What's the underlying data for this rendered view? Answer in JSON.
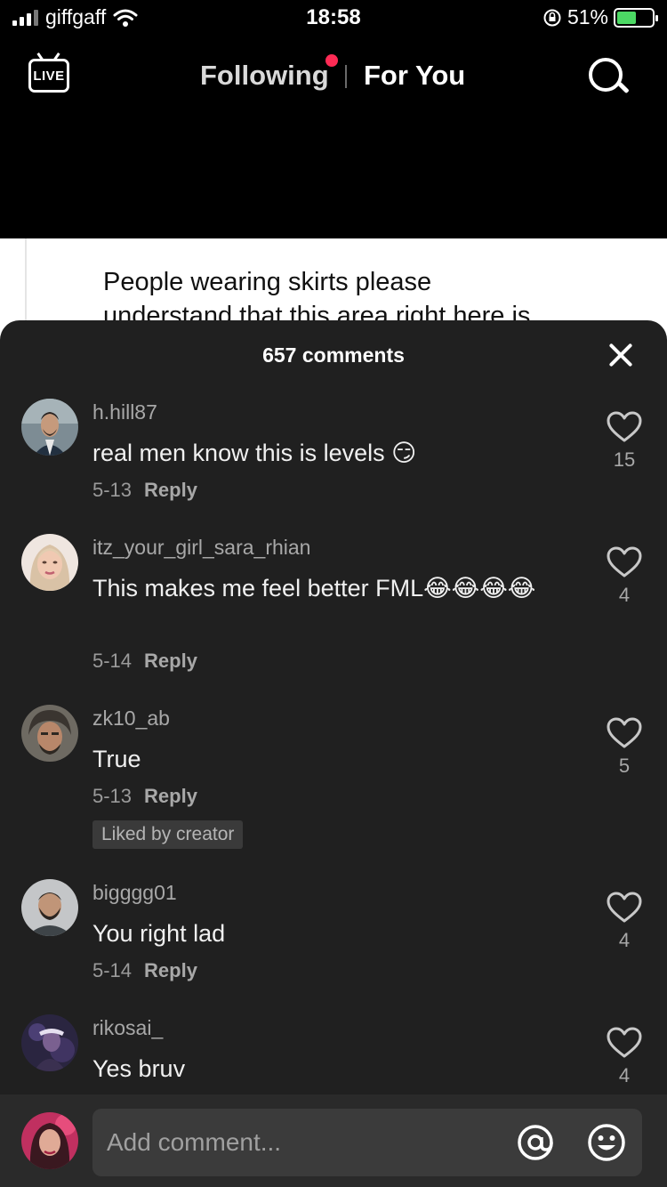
{
  "status_bar": {
    "carrier": "giffgaff",
    "time": "18:58",
    "battery": "51%"
  },
  "top_nav": {
    "live_label": "LIVE",
    "following_label": "Following",
    "for_you_label": "For You"
  },
  "video": {
    "tweet_line1": "People wearing skirts please",
    "tweet_line2": "understand that this area right here is"
  },
  "comments_panel": {
    "count_label": "657 comments",
    "comments": [
      {
        "username": "h.hill87",
        "text": "real men know this is levels 😏",
        "date": "5-13",
        "reply_label": "Reply",
        "likes": "15"
      },
      {
        "username": "itz_your_girl_sara_rhian",
        "text": "This makes me feel better FML😂😂😂😂",
        "date": "5-14",
        "reply_label": "Reply",
        "likes": "4"
      },
      {
        "username": "zk10_ab",
        "text": "True",
        "date": "5-13",
        "reply_label": "Reply",
        "badge": "Liked by creator",
        "likes": "5"
      },
      {
        "username": "bigggg01",
        "text": "You right lad",
        "date": "5-14",
        "reply_label": "Reply",
        "likes": "4"
      },
      {
        "username": "rikosai_",
        "text": "Yes bruv",
        "likes": "4"
      }
    ]
  },
  "input": {
    "placeholder": "Add comment..."
  },
  "icons": {
    "live": "live-tv-icon",
    "search": "search-icon",
    "close": "close-icon",
    "like": "heart-outline-icon",
    "mention": "at-sign-icon",
    "emoji": "smiley-icon"
  },
  "colors": {
    "accent_dot": "#ff2b55",
    "sheet_bg": "#202020",
    "battery_fill": "#4cd964"
  }
}
